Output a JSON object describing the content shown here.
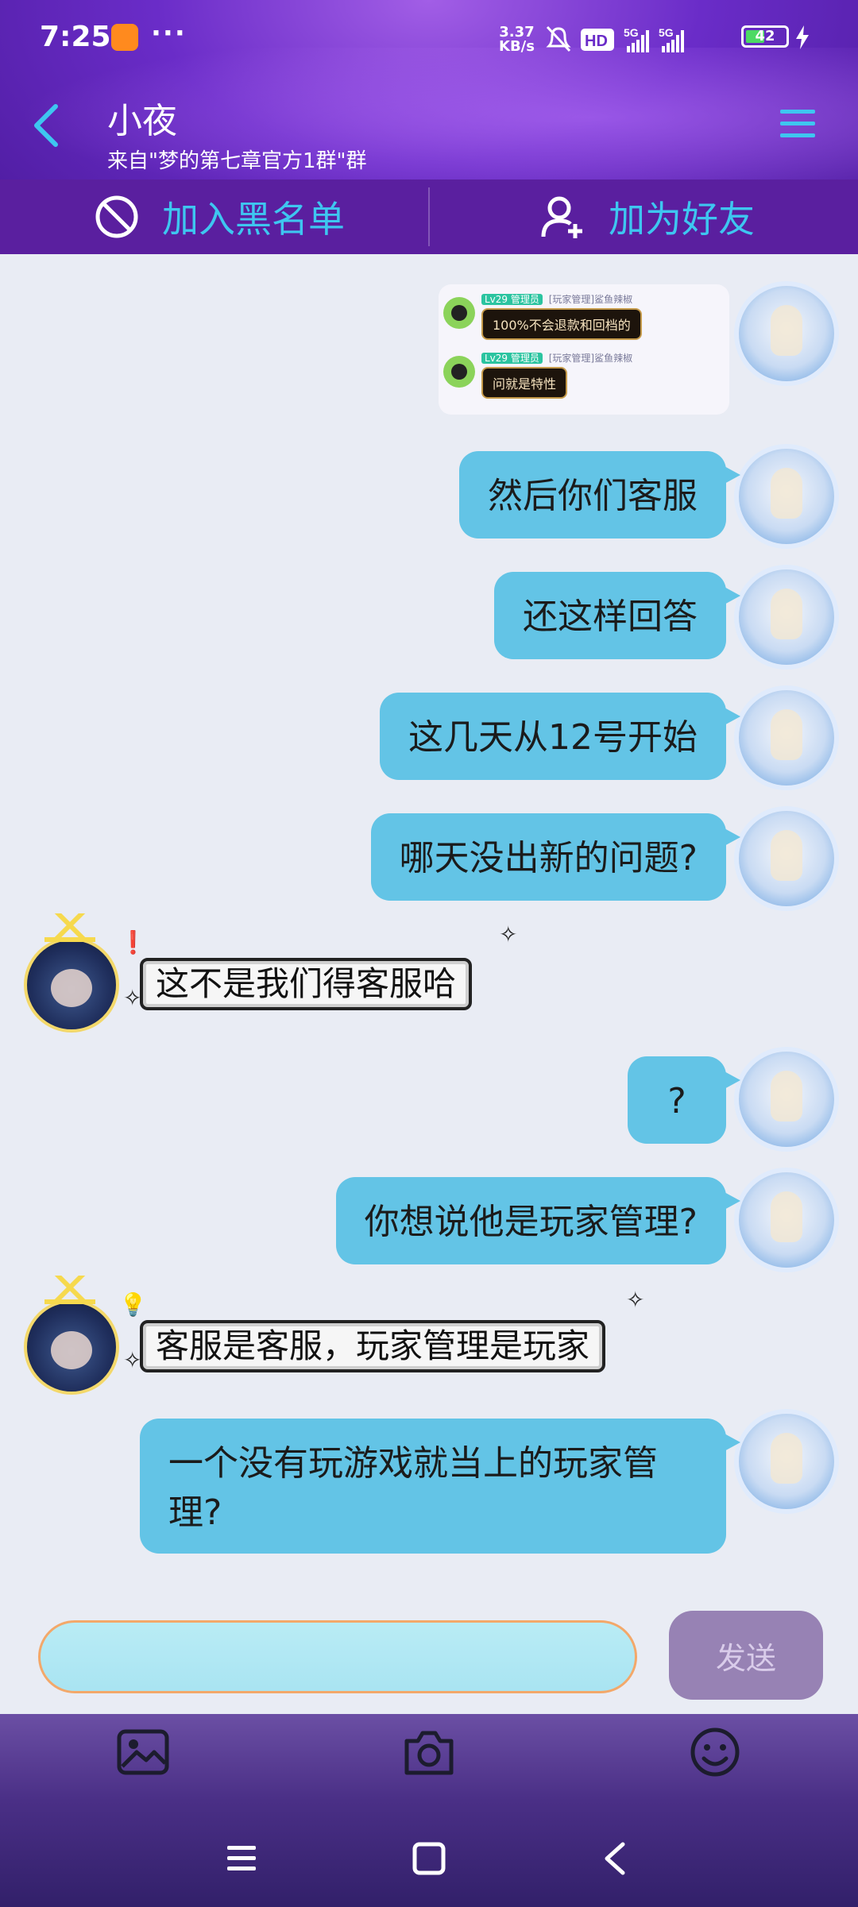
{
  "status_bar": {
    "time": "7:25",
    "more": "···",
    "speed_value": "3.37",
    "speed_unit": "KB/s",
    "battery": "42",
    "network_1": "5G",
    "network_2": "5G",
    "hd": "HD"
  },
  "header": {
    "contact_name": "小夜",
    "contact_subtitle": "来自\"梦的第七章官方1群\"群"
  },
  "actions": {
    "blacklist_label": "加入黑名单",
    "add_friend_label": "加为好友"
  },
  "image_message": {
    "row1_tag": "Lv29 管理员",
    "row1_meta": "[玩家管理]鲨鱼辣椒",
    "row1_text": "100%不会退款和回档的",
    "row2_tag": "Lv29 管理员",
    "row2_meta": "[玩家管理]鲨鱼辣椒",
    "row2_text": "问就是特性"
  },
  "messages": [
    {
      "side": "right",
      "text": "然后你们客服"
    },
    {
      "side": "right",
      "text": "还这样回答"
    },
    {
      "side": "right",
      "text": "这几天从12号开始"
    },
    {
      "side": "right",
      "text": "哪天没出新的问题?"
    },
    {
      "side": "left",
      "text": "这不是我们得客服哈"
    },
    {
      "side": "right",
      "text": "?"
    },
    {
      "side": "right",
      "text": "你想说他是玩家管理?"
    },
    {
      "side": "left",
      "text": "客服是客服，玩家管理是玩家"
    },
    {
      "side": "right",
      "text": "一个没有玩游戏就当上的玩家管理?"
    }
  ],
  "input": {
    "value": "",
    "send_label": "发送"
  },
  "icons": {
    "back": "back-chevron-icon",
    "menu": "hamburger-menu-icon",
    "blacklist": "block-icon",
    "add_friend": "add-user-icon",
    "gallery": "image-icon",
    "camera": "camera-icon",
    "emoji": "emoji-icon"
  },
  "colors": {
    "header": "#6a2cc8",
    "action_bar": "#5a1f9f",
    "action_text": "#3ec6f0",
    "bubble_right": "#63c4e6",
    "send_button": "#9782b4",
    "background": "#e9ecf4"
  }
}
